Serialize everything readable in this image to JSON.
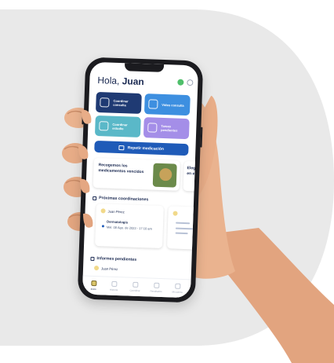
{
  "colors": {
    "background_blob": "#e9e9e9",
    "skin": "#e8b08a",
    "skin_shadow": "#c98b66",
    "phone_frame": "#1b1b1f",
    "primary": "#1f5bb8",
    "navy": "#1f3a73"
  },
  "app": {
    "greeting_prefix": "Hola, ",
    "greeting_name": "Juan",
    "tiles": [
      {
        "label": "Coordinar consulta",
        "icon": "person-icon"
      },
      {
        "label": "Video consulta",
        "icon": "video-icon"
      },
      {
        "label": "Coordinar estudio",
        "icon": "flask-icon"
      },
      {
        "label": "Tareas pendientes",
        "icon": "list-icon"
      }
    ],
    "cta": {
      "label": "Repetir medicación",
      "icon": "pill-icon"
    },
    "promo": {
      "text": "Recogemos los medicamentos vencidos"
    },
    "promo_next": {
      "text": "Elegí\nen el"
    },
    "upcoming_title": "Próximas coordinaciones",
    "appointment": {
      "patient": "Juan Pérez",
      "specialty": "Dermatología",
      "datetime": "Mié. 08 Ago. de 2023 - 17:10 am"
    },
    "reports_title": "Informes pendientes",
    "report": {
      "patient": "Juan Pérez"
    },
    "tabs": [
      {
        "label": "Inicio",
        "active": true
      },
      {
        "label": "Historia"
      },
      {
        "label": "Coordinar"
      },
      {
        "label": "Resultados"
      },
      {
        "label": "Mi cuenta"
      }
    ]
  }
}
